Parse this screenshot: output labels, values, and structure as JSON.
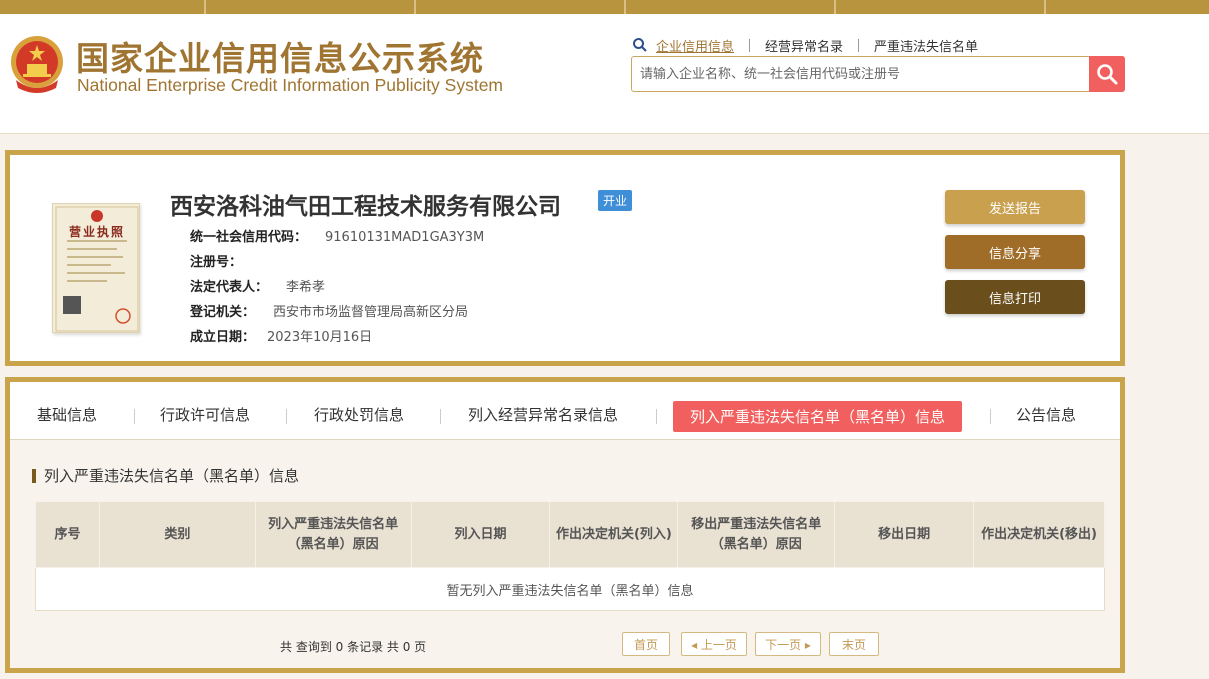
{
  "header": {
    "title_cn": "国家企业信用信息公示系统",
    "title_en": "National Enterprise Credit Information Publicity System",
    "nav": [
      "企业信用信息",
      "经营异常名录",
      "严重违法失信名单"
    ],
    "search_placeholder": "请输入企业名称、统一社会信用代码或注册号"
  },
  "company": {
    "name": "西安洛科油气田工程技术服务有限公司",
    "status": "开业",
    "fields": [
      {
        "label": "统一社会信用代码：",
        "value": "91610131MAD1GA3Y3M"
      },
      {
        "label": "注册号：",
        "value": ""
      },
      {
        "label": "法定代表人：",
        "value": "李希孝"
      },
      {
        "label": "登记机关：",
        "value": "西安市市场监督管理局高新区分局"
      },
      {
        "label": "成立日期：",
        "value": "2023年10月16日"
      }
    ],
    "license_title": "营业执照",
    "actions": [
      "发送报告",
      "信息分享",
      "信息打印"
    ]
  },
  "tabs": [
    "基础信息",
    "行政许可信息",
    "行政处罚信息",
    "列入经营异常名录信息",
    "列入严重违法失信名单（黑名单）信息",
    "公告信息"
  ],
  "section": {
    "title": "列入严重违法失信名单（黑名单）信息",
    "columns": [
      "序号",
      "类别",
      "列入严重违法失信名单（黑名单）原因",
      "列入日期",
      "作出决定机关(列入)",
      "移出严重违法失信名单（黑名单）原因",
      "移出日期",
      "作出决定机关(移出)"
    ],
    "empty_text": "暂无列入严重违法失信名单（黑名单）信息"
  },
  "pager": {
    "info": "共 查询到 0 条记录 共 0 页",
    "first": "首页",
    "prev": "◂ 上一页",
    "next": "下一页 ▸",
    "last": "末页"
  },
  "colors": {
    "gold": "#c9a44a",
    "title": "#a07532",
    "red": "#f1605e",
    "badge": "#3e8ed8",
    "btn1": "#c9a04e",
    "btn2": "#a06d28",
    "btn3": "#6a4f1c"
  }
}
